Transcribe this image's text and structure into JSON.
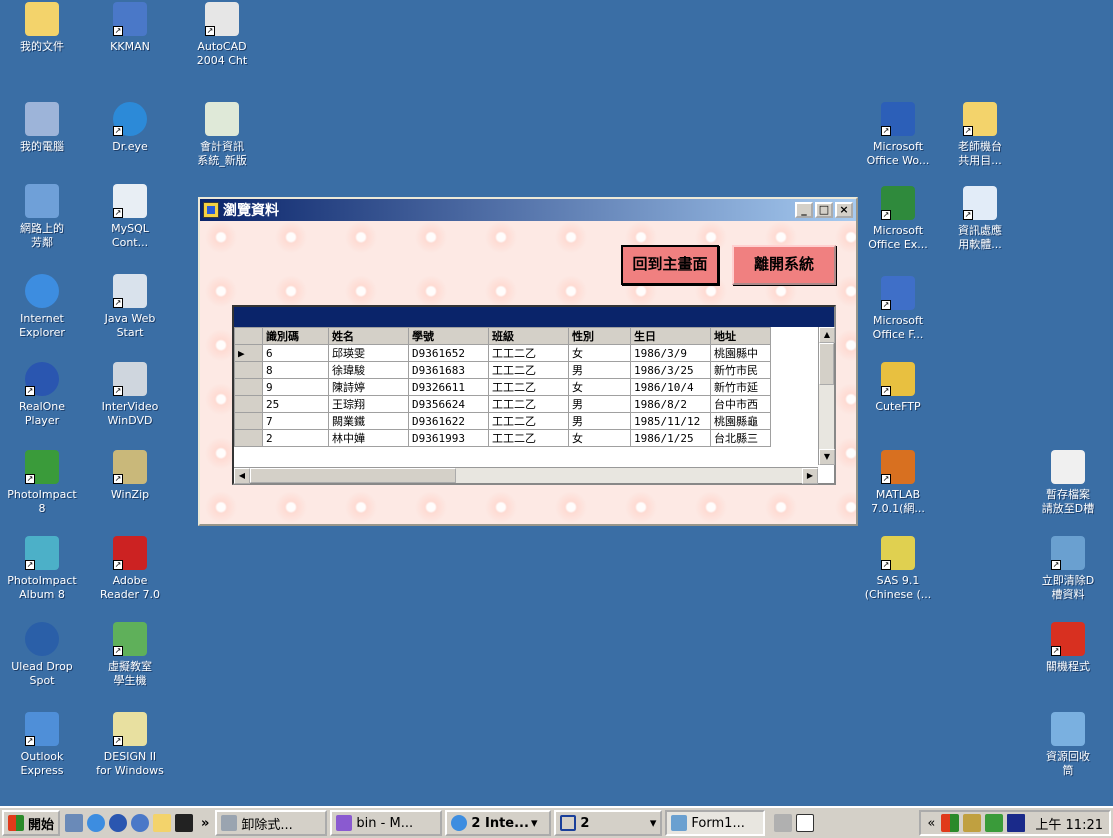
{
  "desktop": {
    "icons": [
      {
        "id": "my-docs",
        "label": "我的文件"
      },
      {
        "id": "kkman",
        "label": "KKMAN"
      },
      {
        "id": "autocad",
        "label": "AutoCAD\n2004 Cht"
      },
      {
        "id": "my-computer",
        "label": "我的電腦"
      },
      {
        "id": "dreye",
        "label": "Dr.eye"
      },
      {
        "id": "accounting",
        "label": "會計資訊\n系統_新版"
      },
      {
        "id": "network",
        "label": "網路上的\n芳鄰"
      },
      {
        "id": "mysql",
        "label": "MySQL\nCont..."
      },
      {
        "id": "ie",
        "label": "Internet\nExplorer"
      },
      {
        "id": "javaws",
        "label": "Java Web\nStart"
      },
      {
        "id": "realone",
        "label": "RealOne\nPlayer"
      },
      {
        "id": "windvd",
        "label": "InterVideo\nWinDVD"
      },
      {
        "id": "photoimpact",
        "label": "PhotoImpact\n8"
      },
      {
        "id": "winzip",
        "label": "WinZip"
      },
      {
        "id": "pi-album",
        "label": "PhotoImpact\nAlbum 8"
      },
      {
        "id": "adobe",
        "label": "Adobe\nReader 7.0"
      },
      {
        "id": "ulead-drop",
        "label": "Ulead Drop\nSpot"
      },
      {
        "id": "vclass",
        "label": "虛擬教室\n學生機"
      },
      {
        "id": "outlook",
        "label": "Outlook\nExpress"
      },
      {
        "id": "design2",
        "label": "DESIGN II\nfor Windows"
      },
      {
        "id": "word",
        "label": "Microsoft\nOffice Wo..."
      },
      {
        "id": "teacher",
        "label": "老師機台\n共用目..."
      },
      {
        "id": "excel",
        "label": "Microsoft\nOffice Ex..."
      },
      {
        "id": "infoapp",
        "label": "資訊處應\n用軟體..."
      },
      {
        "id": "frontpage",
        "label": "Microsoft\nOffice F..."
      },
      {
        "id": "cuteftp",
        "label": "CuteFTP"
      },
      {
        "id": "matlab",
        "label": "MATLAB\n7.0.1(網..."
      },
      {
        "id": "sas",
        "label": "SAS 9.1\n(Chinese (..."
      },
      {
        "id": "tempstore",
        "label": "暫存檔案\n請放至D槽"
      },
      {
        "id": "clear-d",
        "label": "立即清除D\n槽資料"
      },
      {
        "id": "shutdown",
        "label": "關機程式"
      },
      {
        "id": "recycle",
        "label": "資源回收\n筒"
      }
    ]
  },
  "window": {
    "title": "瀏覽資料",
    "btn_home": "回到主畫面",
    "btn_exit": "離開系統",
    "columns": [
      "識別碼",
      "姓名",
      "學號",
      "班級",
      "性別",
      "生日",
      "地址"
    ],
    "rows": [
      [
        "6",
        "邱瑛雯",
        "D9361652",
        "工工二乙",
        "女",
        "1986/3/9",
        "桃園縣中"
      ],
      [
        "8",
        "徐瑋駿",
        "D9361683",
        "工工二乙",
        "男",
        "1986/3/25",
        "新竹市民"
      ],
      [
        "9",
        "陳詩婷",
        "D9326611",
        "工工二乙",
        "女",
        "1986/10/4",
        "新竹市延"
      ],
      [
        "25",
        "王琮翔",
        "D9356624",
        "工工二乙",
        "男",
        "1986/8/2",
        "台中市西"
      ],
      [
        "7",
        "闕業鐵",
        "D9361622",
        "工工二乙",
        "男",
        "1985/11/12",
        "桃園縣龜"
      ],
      [
        "2",
        "林中嬅",
        "D9361993",
        "工工二乙",
        "女",
        "1986/1/25",
        "台北縣三"
      ]
    ]
  },
  "taskbar": {
    "start": "開始",
    "tasks": [
      "卸除式...",
      "bin - M...",
      "2 Inte...",
      "2",
      "Form1..."
    ],
    "clock": "上午 11:21"
  }
}
